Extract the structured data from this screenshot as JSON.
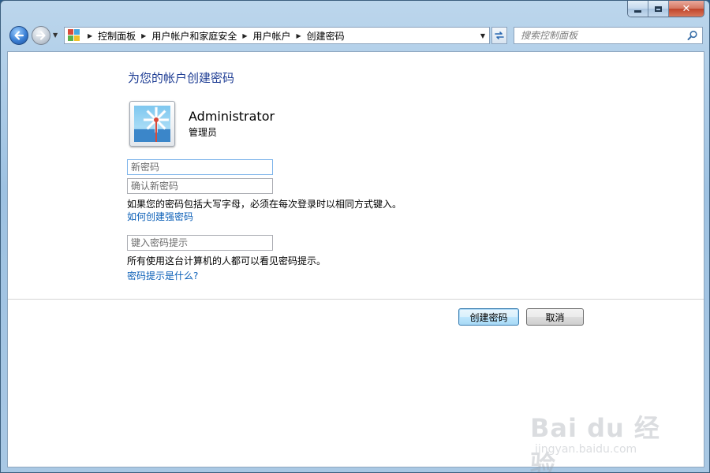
{
  "window": {
    "caption": {
      "minimize": "",
      "maximize": "",
      "close": "✕"
    }
  },
  "navigation": {
    "back_icon": "back-arrow-icon",
    "forward_icon": "forward-arrow-icon",
    "breadcrumb": [
      "控制面板",
      "用户帐户和家庭安全",
      "用户帐户",
      "创建密码"
    ],
    "search_placeholder": "搜索控制面板"
  },
  "page": {
    "title": "为您的帐户创建密码",
    "user": {
      "name": "Administrator",
      "role": "管理员"
    },
    "fields": {
      "new_password_placeholder": "新密码",
      "confirm_password_placeholder": "确认新密码",
      "hint_placeholder": "键入密码提示"
    },
    "case_notice": "如果您的密码包括大写字母，必须在每次登录时以相同方式键入。",
    "strong_password_link": "如何创建强密码",
    "hint_notice": "所有使用这台计算机的人都可以看见密码提示。",
    "hint_link": "密码提示是什么?",
    "buttons": {
      "create": "创建密码",
      "cancel": "取消"
    }
  },
  "watermark": {
    "main": "Bai du 经验",
    "sub": "jingyan.baidu.com"
  },
  "colors": {
    "link": "#0b5fb7",
    "title": "#1e3d94",
    "close_button": "#c0442a"
  }
}
